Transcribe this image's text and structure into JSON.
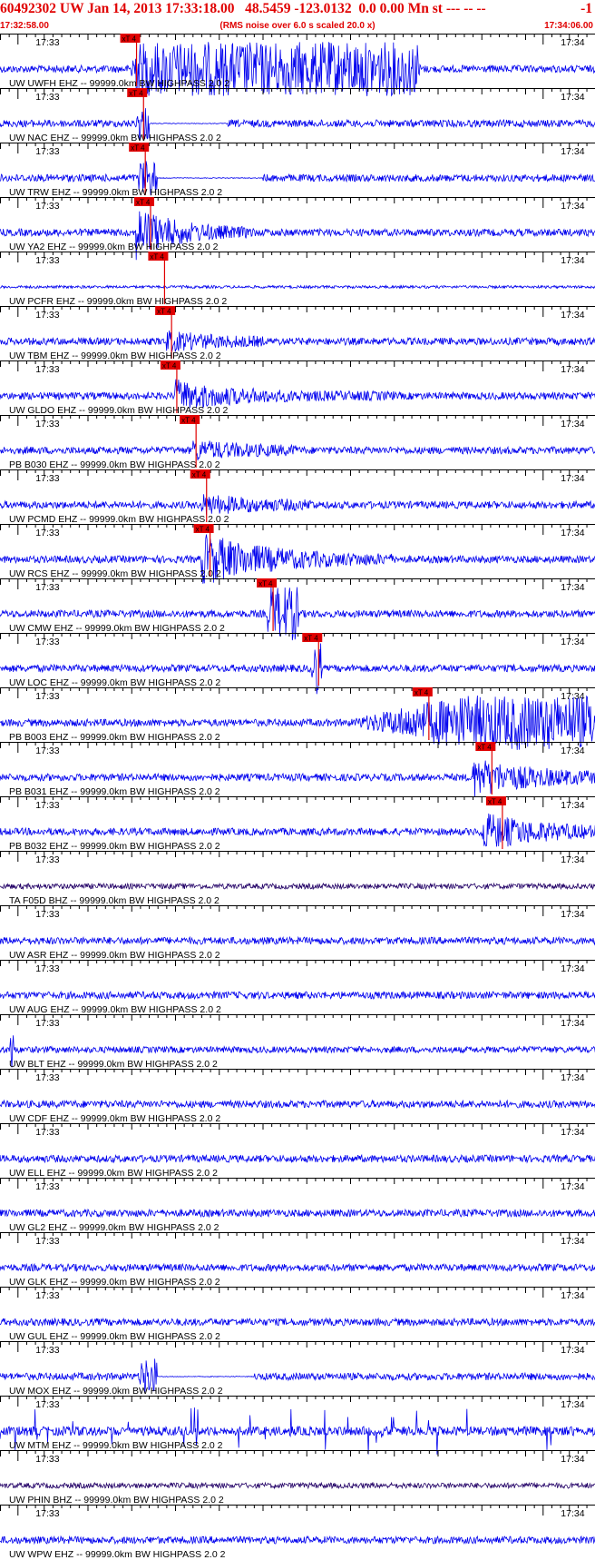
{
  "header": {
    "title": "60492302 UW Jan 14, 2013 17:33:18.00   48.5459 -123.0132  0.0 0.00 Mn st --- -- --",
    "right_flag": "-1",
    "time_start": "17:32:58.00",
    "subtitle": "(RMS noise over 6.0 s scaled 20.0 x)",
    "time_end": "17:34:06.00"
  },
  "colors": {
    "header": "#e00000",
    "trace": "#0000ee",
    "trace_broadband": "#220066",
    "pick": "#e00000",
    "gridline": "#000000",
    "label": "#000000"
  },
  "chart_data": {
    "type": "line",
    "time_range": [
      "17:32:58.00",
      "17:34:06.00"
    ],
    "time_window_s": 68,
    "minute_labels": [
      "17:33",
      "17:34"
    ],
    "minute_marks_s": [
      2,
      62
    ],
    "pick_label": "xT 4",
    "highpass_note": "99999.0km BW  HIGHPASS  2.0  2",
    "channels": [
      {
        "label": "UW UWFH EHZ --",
        "pick_s": 15.6,
        "pattern": "clipped",
        "span_s": [
          15,
          48
        ]
      },
      {
        "label": "UW NAC EHZ --",
        "pick_s": 16.4,
        "pattern": "burst",
        "span_s": [
          15.5,
          26
        ]
      },
      {
        "label": "UW TRW EHZ --",
        "pick_s": 16.6,
        "pattern": "burst",
        "span_s": [
          15.8,
          30
        ]
      },
      {
        "label": "UW YA2 EHZ --",
        "pick_s": 17.2,
        "pattern": "strong",
        "span_s": [
          15.5,
          29
        ]
      },
      {
        "label": "UW PCFR EHZ --",
        "pick_s": 18.8,
        "pattern": "quiet",
        "span_s": [
          18,
          30
        ]
      },
      {
        "label": "UW TBM EHZ --",
        "pick_s": 19.6,
        "pattern": "noise",
        "span_s": [
          19,
          30
        ]
      },
      {
        "label": "UW GLDO EHZ --",
        "pick_s": 20.2,
        "pattern": "event",
        "span_s": [
          20,
          45
        ]
      },
      {
        "label": "PB B030 EHZ --",
        "pick_s": 22.4,
        "pattern": "noise",
        "span_s": [
          22,
          34
        ]
      },
      {
        "label": "UW PCMD EHZ --",
        "pick_s": 23.6,
        "pattern": "noise",
        "span_s": [
          23,
          36
        ]
      },
      {
        "label": "UW RCS EHZ --",
        "pick_s": 24.0,
        "pattern": "strong",
        "span_s": [
          23,
          45
        ]
      },
      {
        "label": "UW CMW EHZ --",
        "pick_s": 31.2,
        "pattern": "clipped_short",
        "span_s": [
          30.5,
          34.2
        ]
      },
      {
        "label": "UW LOC EHZ --",
        "pick_s": 36.4,
        "pattern": "spike",
        "span_s": [
          35.5,
          38
        ]
      },
      {
        "label": "PB B003 EHZ --",
        "pick_s": 49.0,
        "pattern": "late_clip",
        "span_s": [
          40,
          68
        ]
      },
      {
        "label": "PB B031 EHZ --",
        "pick_s": 56.2,
        "pattern": "late_event",
        "span_s": [
          54,
          68
        ]
      },
      {
        "label": "PB B032 EHZ --",
        "pick_s": 57.4,
        "pattern": "late_event",
        "span_s": [
          55,
          68
        ]
      },
      {
        "label": "TA F05D BHZ --",
        "pattern": "quiet_bb"
      },
      {
        "label": "UW ASR EHZ --",
        "pattern": "noise"
      },
      {
        "label": "UW AUG EHZ --",
        "pattern": "noise"
      },
      {
        "label": "UW BLT EHZ --",
        "pattern": "start_spike"
      },
      {
        "label": "UW CDF EHZ --",
        "pattern": "noise"
      },
      {
        "label": "UW ELL EHZ --",
        "pattern": "noise"
      },
      {
        "label": "UW GL2 EHZ --",
        "pattern": "noise"
      },
      {
        "label": "UW GLK EHZ --",
        "pattern": "noise"
      },
      {
        "label": "UW GUL EHZ --",
        "pattern": "noise"
      },
      {
        "label": "UW MOX EHZ --",
        "pattern": "burst_nopick",
        "span_s": [
          16,
          29
        ]
      },
      {
        "label": "UW MTM EHZ --",
        "pattern": "spiky"
      },
      {
        "label": "UW PHIN BHZ --",
        "pattern": "quiet_bb"
      },
      {
        "label": "UW WPW EHZ --",
        "pattern": "noise"
      }
    ]
  }
}
